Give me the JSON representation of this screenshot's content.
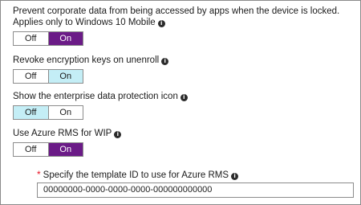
{
  "settings": [
    {
      "label": "Prevent corporate data from being accessed by apps when the device is locked. Applies only to Windows 10 Mobile",
      "off_label": "Off",
      "on_label": "On",
      "selected": "On"
    },
    {
      "label": "Revoke encryption keys on unenroll",
      "off_label": "Off",
      "on_label": "On",
      "selected": "On"
    },
    {
      "label": "Show the enterprise data protection icon",
      "off_label": "Off",
      "on_label": "On",
      "selected": "Off"
    },
    {
      "label": "Use Azure RMS for WIP",
      "off_label": "Off",
      "on_label": "On",
      "selected": "On"
    }
  ],
  "template_id": {
    "required_marker": "*",
    "label": "Specify the template ID to use for Azure RMS",
    "value": "00000000-0000-0000-0000-000000000000"
  },
  "colors": {
    "selected_primary": "#6b1b87",
    "selected_secondary": "#c4eef6",
    "required": "#e81123"
  },
  "icons": {
    "info": "info-icon"
  }
}
